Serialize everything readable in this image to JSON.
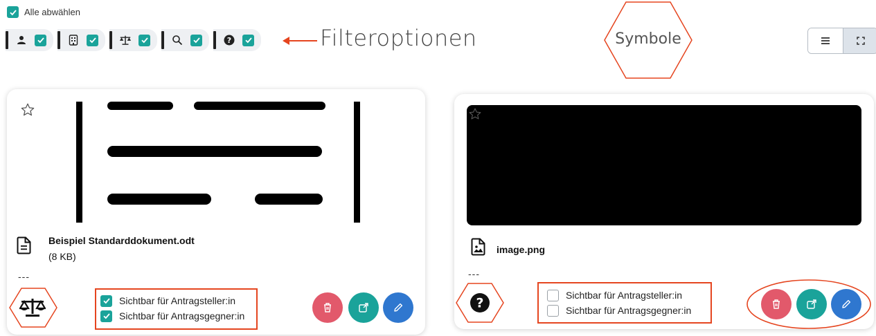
{
  "toolbar": {
    "select_all_label": "Alle abwählen",
    "select_all_checked": true,
    "filters": [
      {
        "icon": "user-icon",
        "checked": true
      },
      {
        "icon": "building-icon",
        "checked": true
      },
      {
        "icon": "scales-icon",
        "checked": true
      },
      {
        "icon": "search-icon",
        "checked": true
      },
      {
        "icon": "question-circle-icon",
        "checked": true
      }
    ],
    "annotation_filter_label": "Filteroptionen",
    "annotation_symbols_label": "Symbole"
  },
  "view_toggle": {
    "options": [
      "list-view-icon",
      "fullscreen-icon"
    ],
    "active": "fullscreen-icon"
  },
  "documents": [
    {
      "file_name": "Beispiel Standarddokument.odt",
      "file_size": "(8 KB)",
      "description": "---",
      "type_icon": "scales-icon",
      "visible_applicant_label": "Sichtbar für Antragsteller:in",
      "visible_applicant": true,
      "visible_opponent_label": "Sichtbar für Antragsgegner:in",
      "visible_opponent": true
    },
    {
      "file_name": "image.png",
      "file_size": "",
      "description": "---",
      "type_icon": "question-circle-icon",
      "visible_applicant_label": "Sichtbar für Antragsteller:in",
      "visible_applicant": false,
      "visible_opponent_label": "Sichtbar für Antragsgegner:in",
      "visible_opponent": false
    }
  ],
  "colors": {
    "accent": "#1aa39a",
    "delete": "#e2596b",
    "edit": "#2f77cf",
    "annotation": "#e5451f"
  }
}
